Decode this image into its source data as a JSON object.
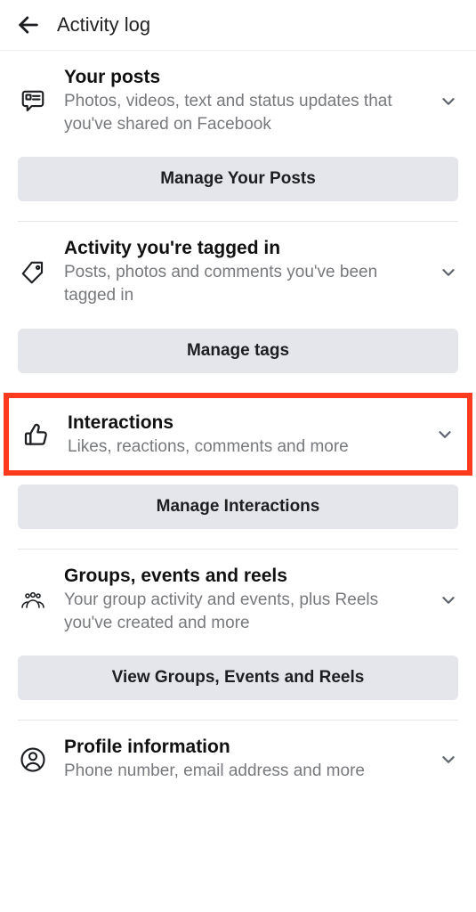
{
  "header": {
    "title": "Activity log"
  },
  "sections": [
    {
      "title": "Your posts",
      "subtitle": "Photos, videos, text and status updates that you've shared on Facebook",
      "button": "Manage Your Posts"
    },
    {
      "title": "Activity you're tagged in",
      "subtitle": "Posts, photos and comments you've been tagged in",
      "button": "Manage tags"
    },
    {
      "title": "Interactions",
      "subtitle": "Likes, reactions, comments and more",
      "button": "Manage Interactions"
    },
    {
      "title": "Groups, events and reels",
      "subtitle": "Your group activity and events, plus Reels you've created and more",
      "button": "View Groups, Events and Reels"
    },
    {
      "title": "Profile information",
      "subtitle": "Phone number, email address and more"
    }
  ]
}
